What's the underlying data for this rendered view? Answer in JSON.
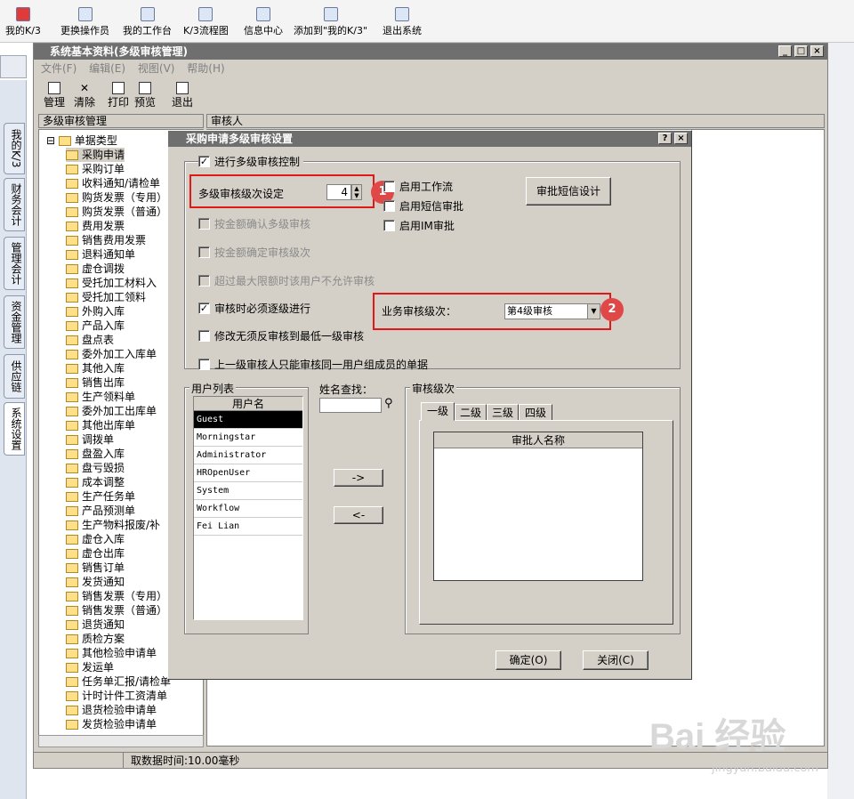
{
  "top_toolbar": {
    "items": [
      "我的K/3",
      "更换操作员",
      "我的工作台",
      "K/3流程图",
      "信息中心",
      "添加到\"我的K/3\"",
      "退出系统"
    ]
  },
  "side_tabs": [
    "我的K/3",
    "财务会计",
    "管理会计",
    "资金管理",
    "供应链",
    "系统设置"
  ],
  "window": {
    "title": "系统基本资料(多级审核管理)",
    "menu": [
      "文件(F)",
      "编辑(E)",
      "视图(V)",
      "帮助(H)"
    ],
    "toolbar": [
      "管理",
      "清除",
      "打印",
      "预览",
      "退出"
    ],
    "left_header": "多级审核管理",
    "right_header": "审核人",
    "tree_root": "单据类型",
    "tree_items": [
      "采购申请",
      "采购订单",
      "收料通知/请检单",
      "购货发票（专用）",
      "购货发票（普通）",
      "费用发票",
      "销售费用发票",
      "退料通知单",
      "虚仓调拨",
      "受托加工材料入",
      "受托加工领料",
      "外购入库",
      "产品入库",
      "盘点表",
      "委外加工入库单",
      "其他入库",
      "销售出库",
      "生产领料单",
      "委外加工出库单",
      "其他出库单",
      "调拨单",
      "盘盈入库",
      "盘亏毁损",
      "成本调整",
      "生产任务单",
      "产品预测单",
      "生产物料报废/补",
      "虚仓入库",
      "虚仓出库",
      "销售订单",
      "发货通知",
      "销售发票（专用）",
      "销售发票（普通）",
      "退货通知",
      "质检方案",
      "其他检验申请单",
      "发运单",
      "任务单汇报/请检单",
      "计时计件工资清单",
      "退货检验申请单",
      "发货检验申请单"
    ],
    "status": "取数据时间:10.00毫秒"
  },
  "dialog": {
    "title": "采购申请多级审核设置",
    "help": "?",
    "close": "×",
    "enable_multilevel": "进行多级审核控制",
    "level_setting_label": "多级审核级次设定",
    "level_value": "4",
    "workflow": "启用工作流",
    "sms_approve": "启用短信审批",
    "im_approve": "启用IM审批",
    "sms_design": "审批短信设计",
    "by_amount_confirm": "按金额确认多级审核",
    "by_amount_level": "按金额确定审核级次",
    "over_limit": "超过最大限额时该用户不允许审核",
    "step_by_step": "审核时必须逐级进行",
    "modify_unaudit": "修改无须反审核到最低一级审核",
    "business_level_label": "业务审核级次：",
    "business_level_value": "第4级审核",
    "same_group": "上一级审核人只能审核同一用户组成员的单据",
    "user_list_title": "用户列表",
    "user_col": "用户名",
    "users": [
      "Guest",
      "Morningstar",
      "Administrator",
      "HROpenUser",
      "System",
      "Workflow",
      "Fei Lian"
    ],
    "name_search": "姓名查找：",
    "add_btn": "->",
    "remove_btn": "<-",
    "level_group": "审核级次",
    "level_tabs": [
      "一级",
      "二级",
      "三级",
      "四级"
    ],
    "approver_col": "审批人名称",
    "ok": "确定(O)",
    "close_btn": "关闭(C)",
    "badge1": "1",
    "badge2": "2"
  },
  "watermark": {
    "text": "Bai 经验",
    "url": "jingyan.baidu.com"
  }
}
